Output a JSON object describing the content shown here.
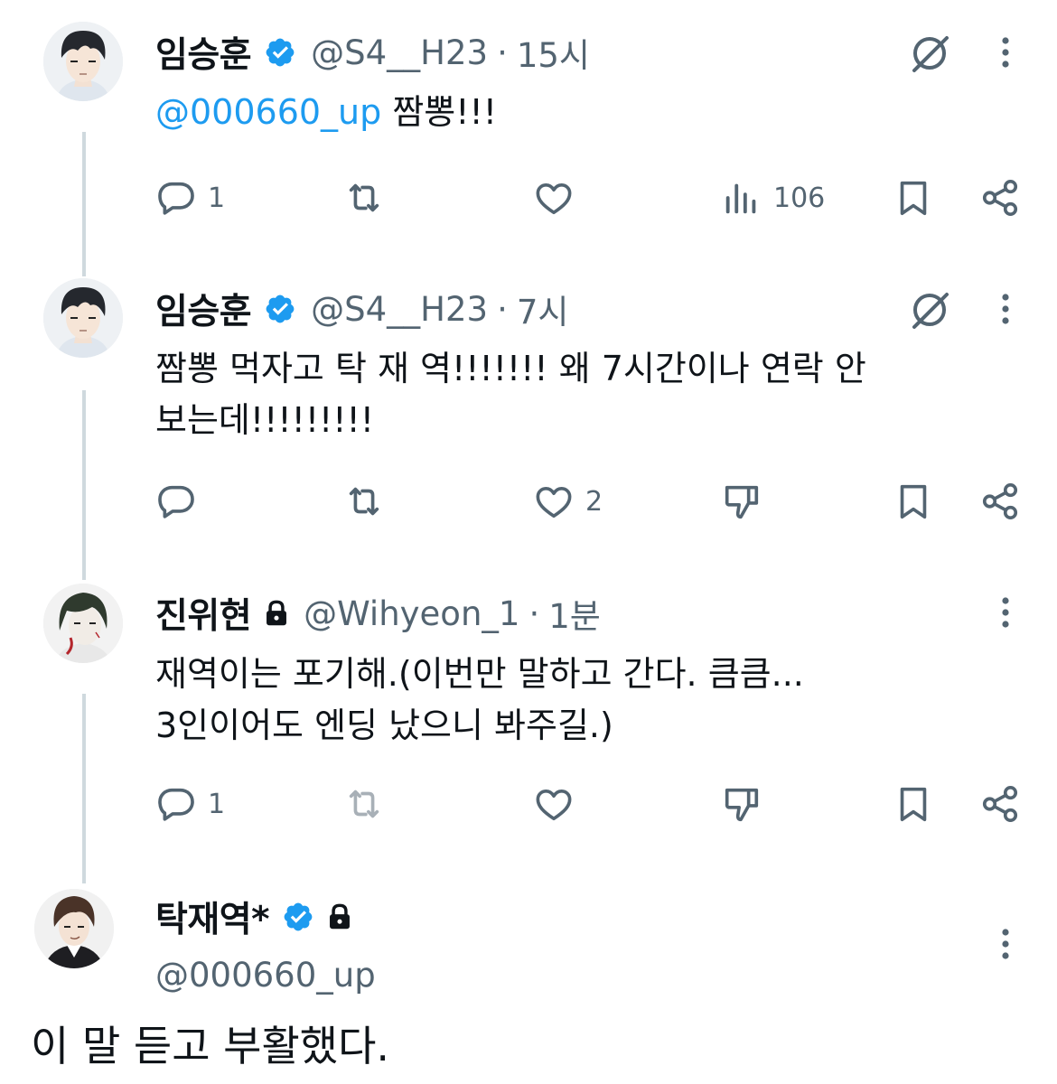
{
  "posts": [
    {
      "name": "임승훈",
      "handle": "@S4__H23",
      "dot": "·",
      "time": "15시",
      "mention": "@000660_up",
      "text": " 짬뽕!!!",
      "replies": "1",
      "retweets": "",
      "likes": "",
      "views": "106"
    },
    {
      "name": "임승훈",
      "handle": "@S4__H23",
      "dot": "·",
      "time": "7시",
      "text_line1": "짬뽕 먹자고 탁 재 역!!!!!!! 왜 7시간이나 연락 안",
      "text_line2": "보는데!!!!!!!!!",
      "replies": "",
      "retweets": "",
      "likes": "2"
    },
    {
      "name": "진위현",
      "handle": "@Wihyeon_1",
      "dot": "·",
      "time": "1분",
      "text_line1": "재역이는 포기해.(이번만 말하고 간다. 큼큼...",
      "text_line2": "3인이어도 엔딩 났으니 봐주길.)",
      "replies": "1",
      "retweets": "",
      "likes": ""
    },
    {
      "name": "탁재역*",
      "handle": "@000660_up",
      "text": "이 말 듣고 부활했다."
    }
  ],
  "colors": {
    "accent": "#1d9bf0",
    "text_primary": "#0f1419",
    "text_secondary": "#536471",
    "thread_line": "#cfd9de"
  },
  "icons": {
    "verified": "verified-badge-icon",
    "protected": "lock-icon",
    "reply": "reply-icon",
    "retweet": "retweet-icon",
    "like": "heart-icon",
    "views": "views-icon",
    "dislike": "thumbs-down-icon",
    "bookmark": "bookmark-icon",
    "share": "share-icon",
    "more": "more-icon",
    "grok": "grok-icon"
  }
}
